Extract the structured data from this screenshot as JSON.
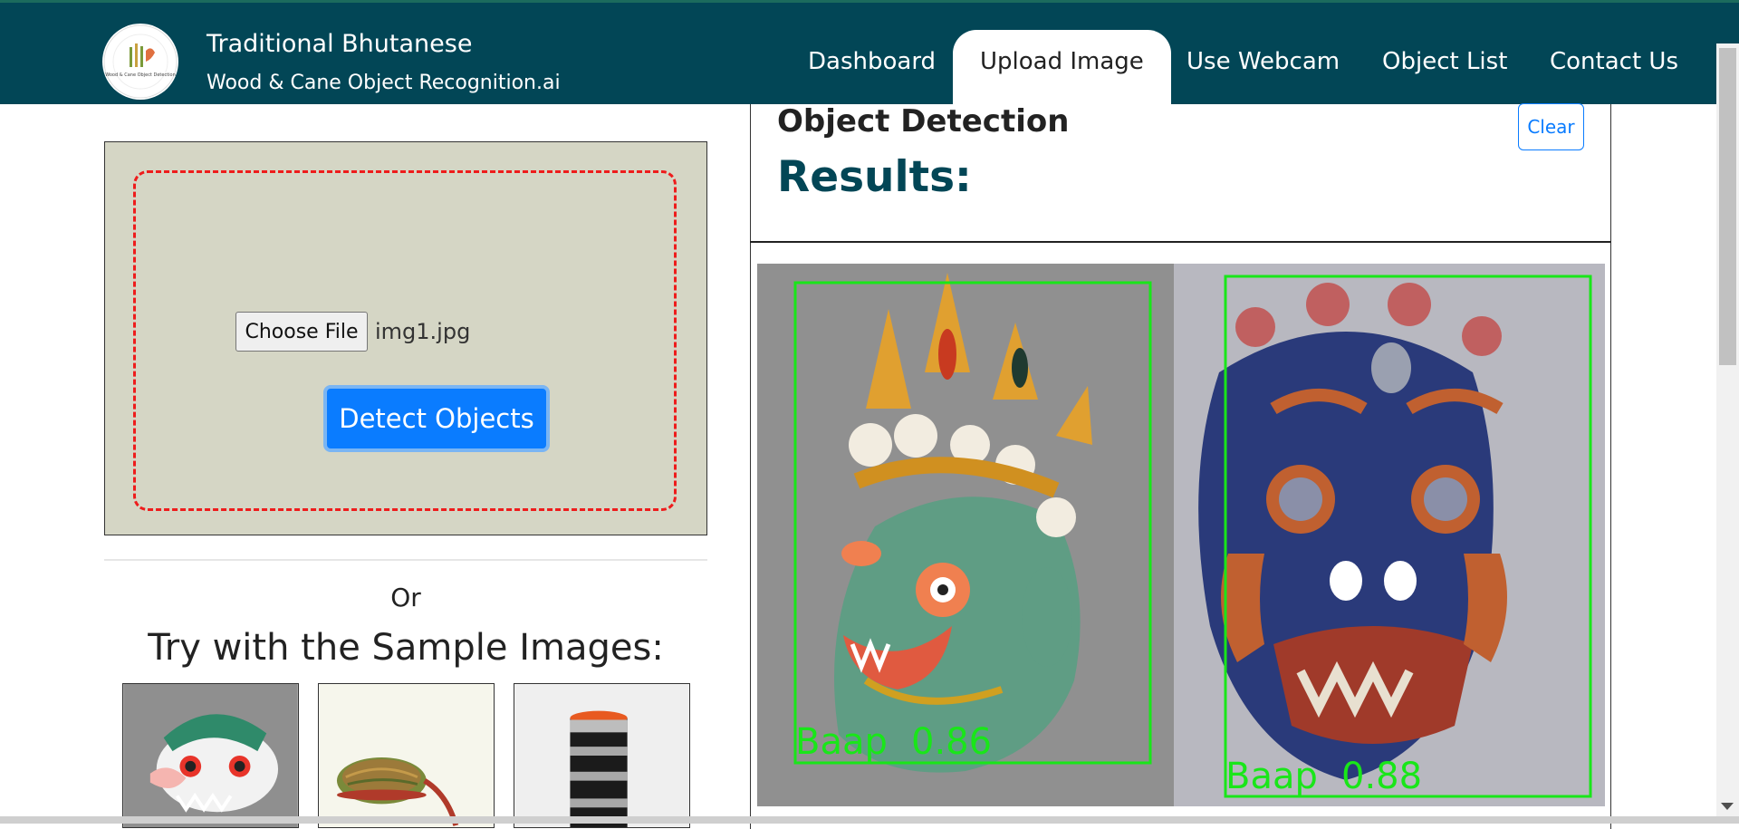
{
  "nav": {
    "brand_title": "Traditional Bhutanese",
    "brand_subtitle": "Wood & Cane Object Recognition.ai",
    "logo_text_top": "TRADITIONAL BHUTANESE",
    "logo_text_center": "Wood & Cane Object Detection",
    "links": [
      {
        "label": "Dashboard",
        "active": false
      },
      {
        "label": "Upload Image",
        "active": true
      },
      {
        "label": "Use Webcam",
        "active": false
      },
      {
        "label": "Object List",
        "active": false
      },
      {
        "label": "Contact Us",
        "active": false
      }
    ]
  },
  "upload": {
    "choose_file_label": "Choose File",
    "file_name": "img1.jpg",
    "detect_label": "Detect Objects"
  },
  "samples": {
    "or_label": "Or",
    "heading": "Try with the Sample Images:",
    "items": [
      {
        "icon": "white-mask-icon"
      },
      {
        "icon": "cane-basket-icon"
      },
      {
        "icon": "cylinder-container-icon"
      }
    ]
  },
  "results": {
    "title": "Object Detection",
    "results_label": "Results:",
    "clear_label": "Clear",
    "detections": [
      {
        "label": "Baap",
        "confidence": "0.86"
      },
      {
        "label": "Baap",
        "confidence": "0.88"
      }
    ],
    "box_color": "#19e619"
  },
  "colors": {
    "navbar": "#024656",
    "primary_button": "#0a7cff",
    "drop_zone_border": "#ee1c1c",
    "upload_background": "#d5d6c5"
  }
}
